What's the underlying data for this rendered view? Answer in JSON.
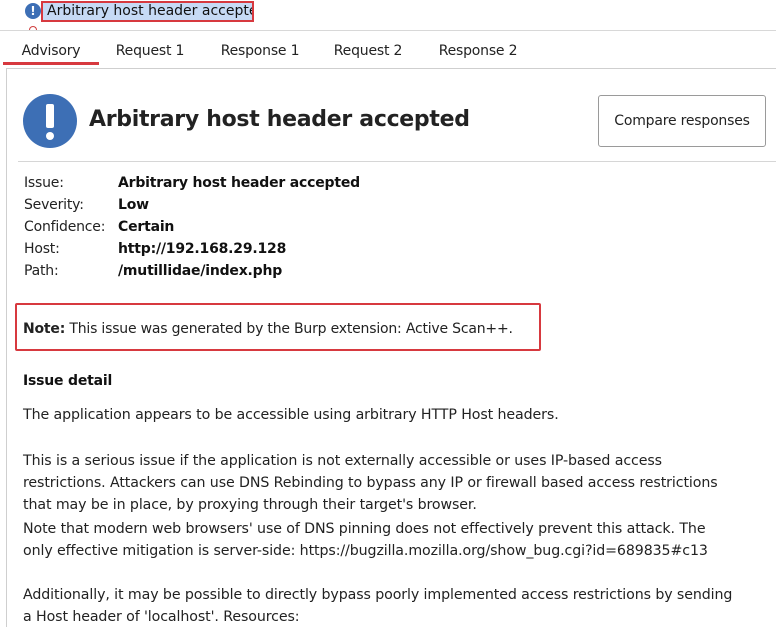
{
  "issue_tree": {
    "selected_item": "Arbitrary host header accepted",
    "icon": "info-icon"
  },
  "tabs": [
    "Advisory",
    "Request 1",
    "Response 1",
    "Request 2",
    "Response 2"
  ],
  "active_tab": "Advisory",
  "advisory": {
    "icon": "info-icon",
    "title": "Arbitrary host header accepted",
    "compare_button": "Compare responses",
    "meta": {
      "issue_label": "Issue:",
      "issue_value": "Arbitrary host header accepted",
      "severity_label": "Severity:",
      "severity_value": "Low",
      "confidence_label": "Confidence:",
      "confidence_value": "Certain",
      "host_label": "Host:",
      "host_value": "http://192.168.29.128",
      "path_label": "Path:",
      "path_value": "/mutillidae/index.php"
    },
    "note_label": "Note:",
    "note_text": " This issue was generated by the Burp extension: Active Scan++.",
    "detail_heading": "Issue detail",
    "detail_lines": {
      "p1": "The application appears to be accessible using arbitrary HTTP Host headers.",
      "p2a": "This is a serious issue if the application is not externally accessible or uses IP-based access",
      "p2b": "restrictions. Attackers can use DNS Rebinding to bypass any IP or firewall based access restrictions",
      "p2c": "that may be in place, by proxying through their target's browser.",
      "p3a": "Note that modern web browsers' use of DNS pinning does not effectively prevent this attack. The",
      "p3b": "only effective mitigation is server-side: https://bugzilla.mozilla.org/show_bug.cgi?id=689835#c13",
      "p4a": "Additionally, it may be possible to directly bypass poorly implemented access restrictions by sending",
      "p4b": "a Host header of 'localhost'. Resources:"
    }
  },
  "colors": {
    "accent_red": "#d7393f",
    "info_blue": "#3d6fb5",
    "selection_bg": "#c6daf5"
  }
}
